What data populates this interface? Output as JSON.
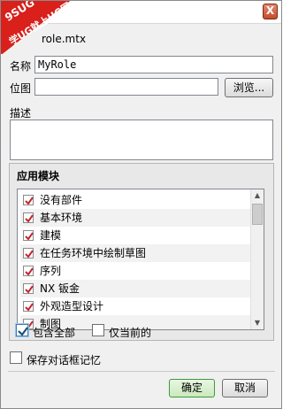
{
  "watermark": {
    "line1": "9SUG",
    "line2": "学UG就上UG网"
  },
  "titlebar": {
    "close_label": "X"
  },
  "file": {
    "name": "role.mtx"
  },
  "form": {
    "name_label": "名称",
    "name_value": "MyRole",
    "bitmap_label": "位图",
    "bitmap_value": "",
    "browse_label": "浏览...",
    "description_label": "描述",
    "description_value": ""
  },
  "modules": {
    "group_title": "应用模块",
    "items": [
      {
        "label": "没有部件",
        "checked": true
      },
      {
        "label": "基本环境",
        "checked": true
      },
      {
        "label": "建模",
        "checked": true
      },
      {
        "label": "在任务环境中绘制草图",
        "checked": true
      },
      {
        "label": "序列",
        "checked": true
      },
      {
        "label": "NX 钣金",
        "checked": true
      },
      {
        "label": "外观造型设计",
        "checked": true
      },
      {
        "label": "制图",
        "checked": true
      }
    ],
    "include_all_label": "包含全部",
    "include_all_checked": true,
    "current_only_label": "仅当前的",
    "current_only_checked": false
  },
  "save_memory": {
    "label": "保存对话框记忆",
    "checked": false
  },
  "footer": {
    "ok_label": "确定",
    "cancel_label": "取消"
  }
}
